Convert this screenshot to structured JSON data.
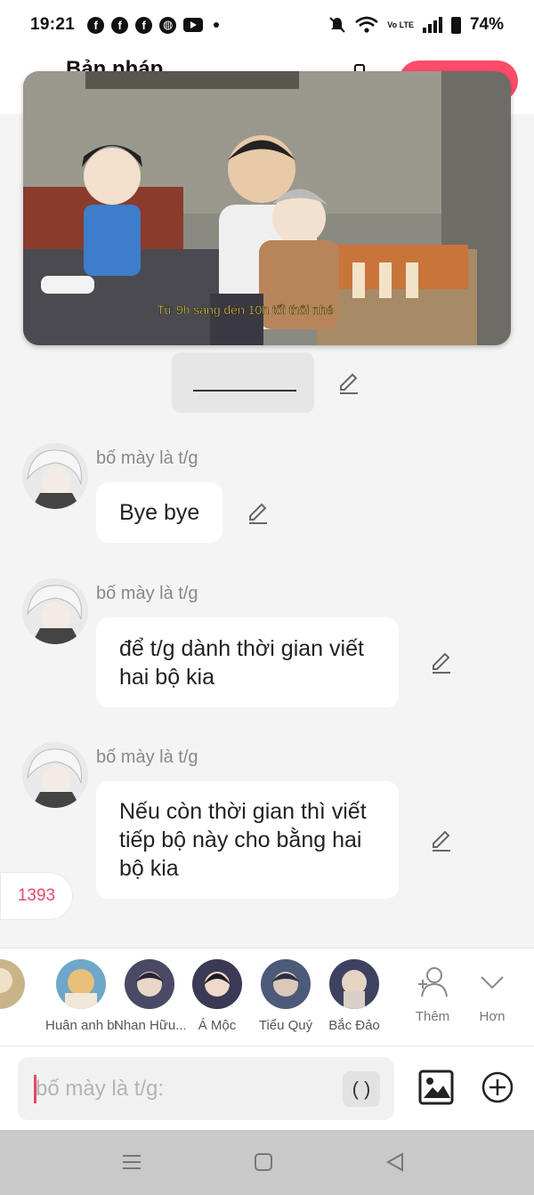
{
  "status_bar": {
    "time": "19:21",
    "network": "Vo LTE",
    "battery": "74%"
  },
  "header": {
    "title": "Bản nháp"
  },
  "video": {
    "subtitle": "Từ 9h sáng đến 10h tối thôi nhé"
  },
  "messages": [
    {
      "sender": "bố mày là t/g",
      "text": "Bye bye"
    },
    {
      "sender": "bố mày là t/g",
      "text": "để t/g dành thời gian viết hai bộ kia"
    },
    {
      "sender": "bố mày là t/g",
      "text": "Nếu còn thời gian thì viết tiếp bộ này cho bằng hai bộ kia"
    }
  ],
  "counter": "1393",
  "characters": [
    {
      "name": "Huân anh béo y...",
      "color": "#e8c07a"
    },
    {
      "name": "Nhan Hữu...",
      "color": "#4a4a66"
    },
    {
      "name": "Á Mộc",
      "color": "#3a3a55"
    },
    {
      "name": "Tiểu Quý",
      "color": "#4d5a7a"
    },
    {
      "name": "Bắc Đảo",
      "color": "#3d4260"
    }
  ],
  "partial_character": {
    "color": "#c9b48a"
  },
  "actions": {
    "add_label": "Thêm",
    "more_label": "Hơn"
  },
  "input": {
    "placeholder": "bố mày là t/g:",
    "paren_label": "( )"
  },
  "colors": {
    "accent": "#ff4b6a",
    "counter": "#e24a6a"
  }
}
